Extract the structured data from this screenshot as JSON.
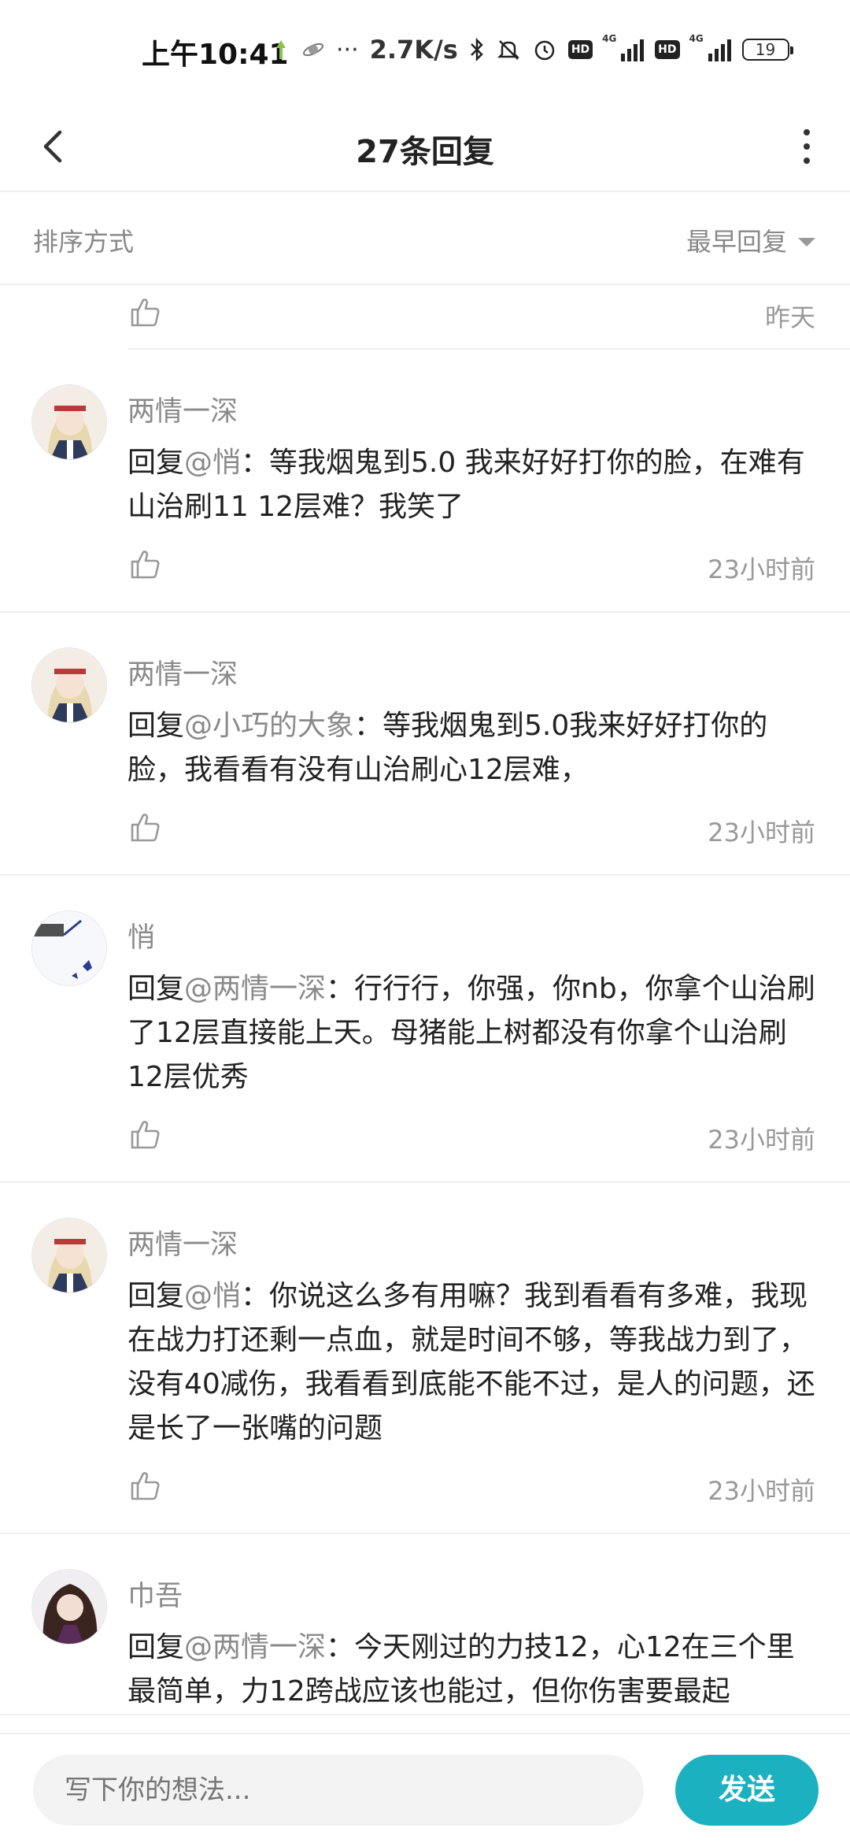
{
  "status_bar": {
    "time": "上午10:41",
    "net_speed": "2.7K/s",
    "hd1": "HD",
    "hd2": "HD",
    "sig1_label": "4G",
    "sig2_label": "4G",
    "battery": "19"
  },
  "header": {
    "title": "27条回复"
  },
  "sort": {
    "label": "排序方式",
    "value": "最早回复"
  },
  "replies": [
    {
      "time": "昨天"
    },
    {
      "name": "两情一深",
      "prefix": "回复",
      "mention": "@悄",
      "text": "：等我烟鬼到5.0  我来好好打你的脸，在难有山治刷11  12层难？我笑了",
      "time": "23小时前"
    },
    {
      "name": "两情一深",
      "prefix": "回复",
      "mention": "@小巧的大象",
      "text": "：等我烟鬼到5.0我来好好打你的脸，我看看有没有山治刷心12层难，",
      "time": "23小时前"
    },
    {
      "name": "悄",
      "prefix": "回复",
      "mention": "@两情一深",
      "text": "：行行行，你强，你nb，你拿个山治刷了12层直接能上天。母猪能上树都没有你拿个山治刷12层优秀",
      "time": "23小时前"
    },
    {
      "name": "两情一深",
      "prefix": "回复",
      "mention": "@悄",
      "text": "：你说这么多有用嘛？我到看看有多难，我现在战力打还剩一点血，就是时间不够，等我战力到了，没有40减伤，我看看到底能不能不过，是人的问题，还是长了一张嘴的问题",
      "time": "23小时前"
    },
    {
      "name": "巾吾",
      "prefix": "回复",
      "mention": "@两情一深",
      "text": "：今天刚过的力技12，心12在三个里最简单，力12跨战应该也能过，但你伤害要最起"
    }
  ],
  "composer": {
    "placeholder": "写下你的想法...",
    "send_label": "发送"
  },
  "colors": {
    "accent": "#1bb1c1",
    "muted": "#8a8a8a",
    "divider": "#eeeeee"
  }
}
